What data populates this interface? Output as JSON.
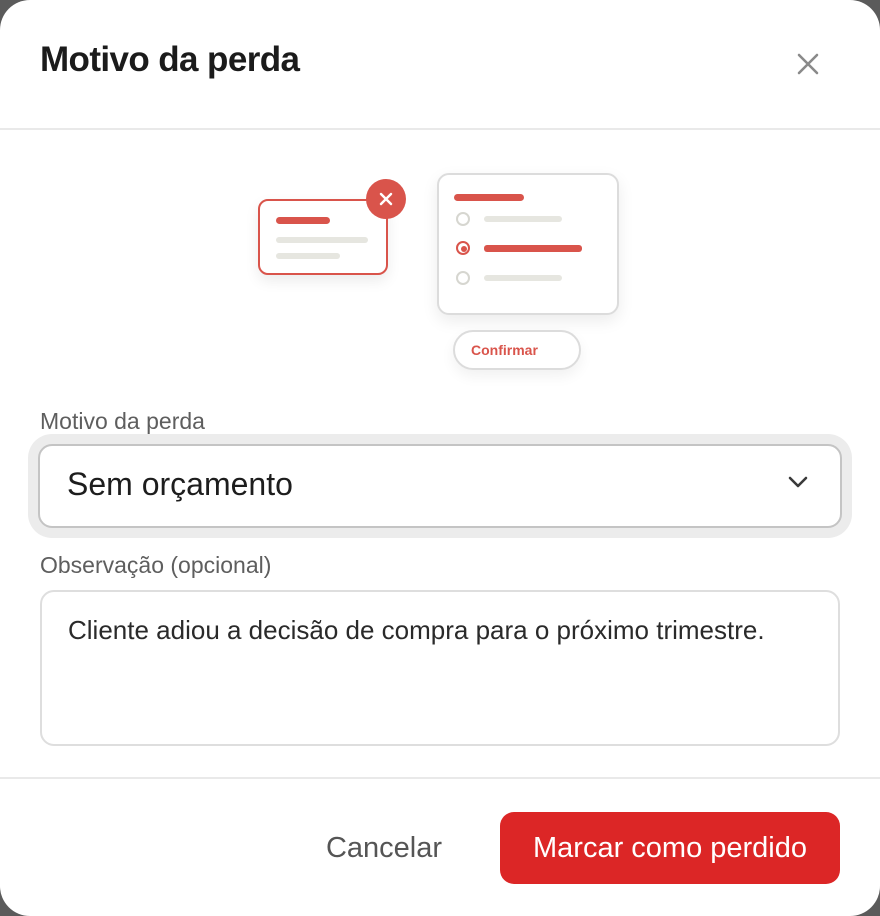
{
  "dialog": {
    "title": "Motivo da perda",
    "close_icon": "close-icon"
  },
  "illustration": {
    "confirm_label": "Confirmar",
    "accent_color": "#d9544b"
  },
  "form": {
    "reason_label": "Motivo da perda",
    "reason_value": "Sem orçamento",
    "note_label": "Observação (opcional)",
    "note_value": "Cliente adiou a decisão de compra para o próximo trimestre."
  },
  "footer": {
    "cancel_label": "Cancelar",
    "submit_label": "Marcar como perdido",
    "submit_color": "#dc2626"
  }
}
